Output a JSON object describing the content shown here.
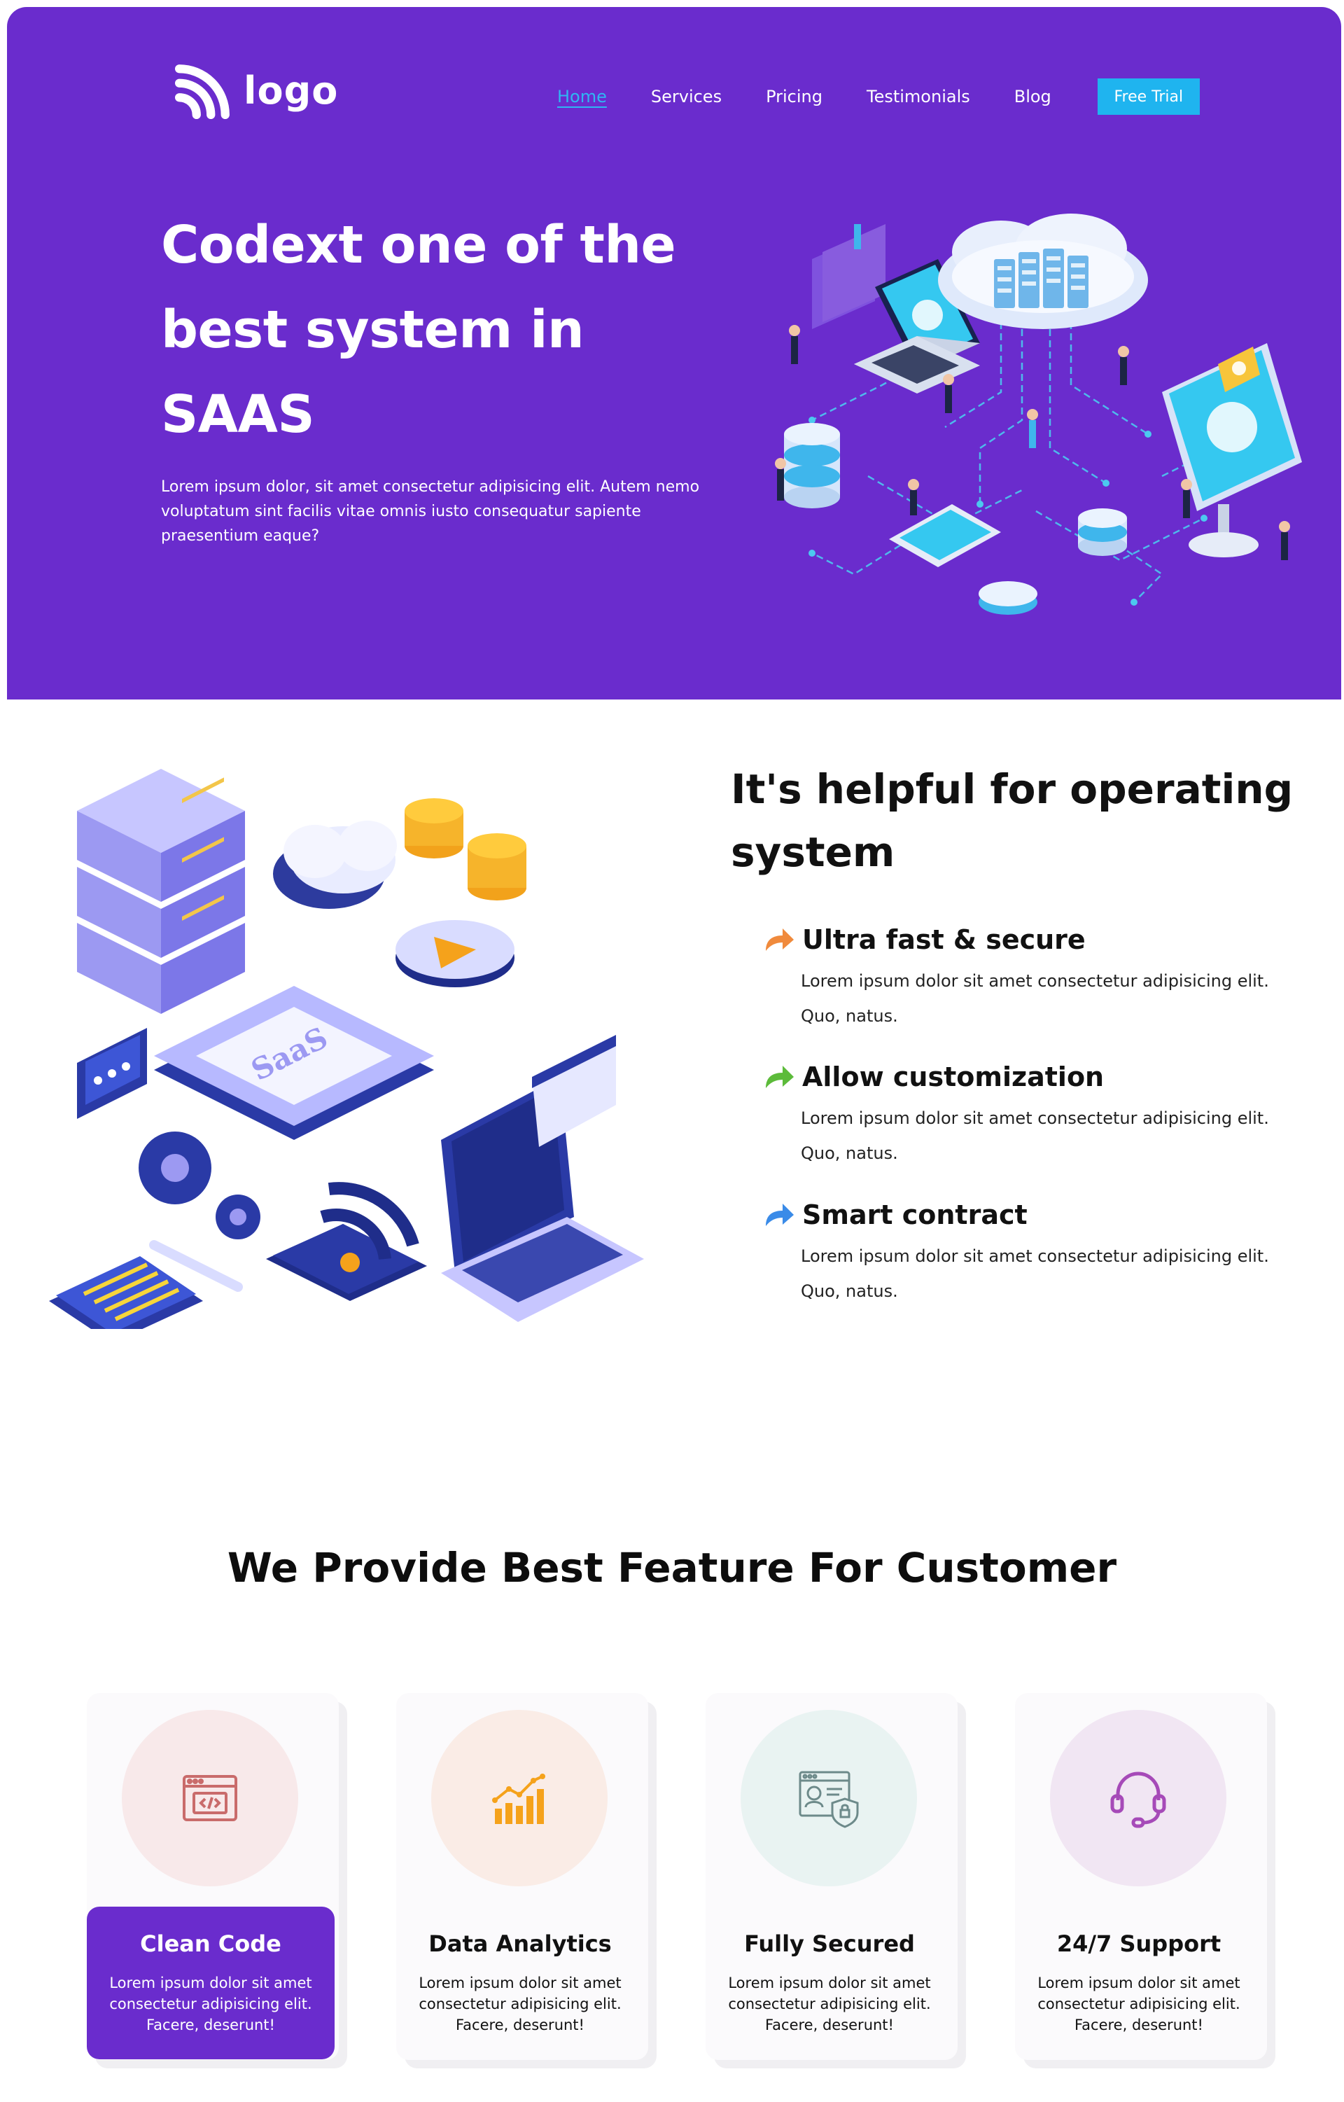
{
  "brand": {
    "logo_text": "logo"
  },
  "nav": {
    "items": [
      {
        "label": "Home",
        "active": true
      },
      {
        "label": "Services"
      },
      {
        "label": "Pricing"
      },
      {
        "label": "Testimonials"
      },
      {
        "label": "Blog"
      }
    ],
    "cta_label": "Free Trial"
  },
  "hero": {
    "title_lines": [
      "Codext one of the",
      "best system in",
      "SAAS"
    ],
    "description": "Lorem ipsum dolor, sit amet consectetur adipisicing elit. Autem nemo voluptatum sint facilis vitae omnis iusto consequatur sapiente praesentium eaque?"
  },
  "about": {
    "title_lines": [
      "It's helpful for operating",
      "system"
    ],
    "illustration_label": "SaaS",
    "points": [
      {
        "title": "Ultra fast & secure",
        "text": "Lorem ipsum dolor sit amet consectetur adipisicing elit. Quo, natus.",
        "icon": "arrow-icon",
        "color": "#f08a3c"
      },
      {
        "title": "Allow customization",
        "text": "Lorem ipsum dolor sit amet consectetur adipisicing elit. Quo, natus.",
        "icon": "arrow-icon",
        "color": "#5cbb3a"
      },
      {
        "title": "Smart contract",
        "text": "Lorem ipsum dolor sit amet consectetur adipisicing elit. Quo, natus.",
        "icon": "arrow-icon",
        "color": "#3a8be8"
      }
    ]
  },
  "features": {
    "title": "We Provide Best Feature For Customer",
    "cards": [
      {
        "title": "Clean Code",
        "text": "Lorem ipsum dolor sit amet consectetur adipisicing elit. Facere, deserunt!",
        "icon": "code-window-icon",
        "icon_color": "#c96b6b",
        "circle_color": "#f8e9ea",
        "active": true
      },
      {
        "title": "Data Analytics",
        "text": "Lorem ipsum dolor sit amet consectetur adipisicing elit. Facere, deserunt!",
        "icon": "bar-chart-icon",
        "icon_color": "#f5a21b",
        "circle_color": "#faece6",
        "active": false
      },
      {
        "title": "Fully Secured",
        "text": "Lorem ipsum dolor sit amet consectetur adipisicing elit. Facere, deserunt!",
        "icon": "secure-profile-icon",
        "icon_color": "#6d8a8a",
        "circle_color": "#e9f3f2",
        "active": false
      },
      {
        "title": "24/7 Support",
        "text": "Lorem ipsum dolor sit amet consectetur adipisicing elit. Facere, deserunt!",
        "icon": "headset-icon",
        "icon_color": "#a64ab8",
        "circle_color": "#f1e6f3",
        "active": false
      }
    ]
  },
  "colors": {
    "primary": "#6a2ccd",
    "accent": "#1fb4ef"
  }
}
